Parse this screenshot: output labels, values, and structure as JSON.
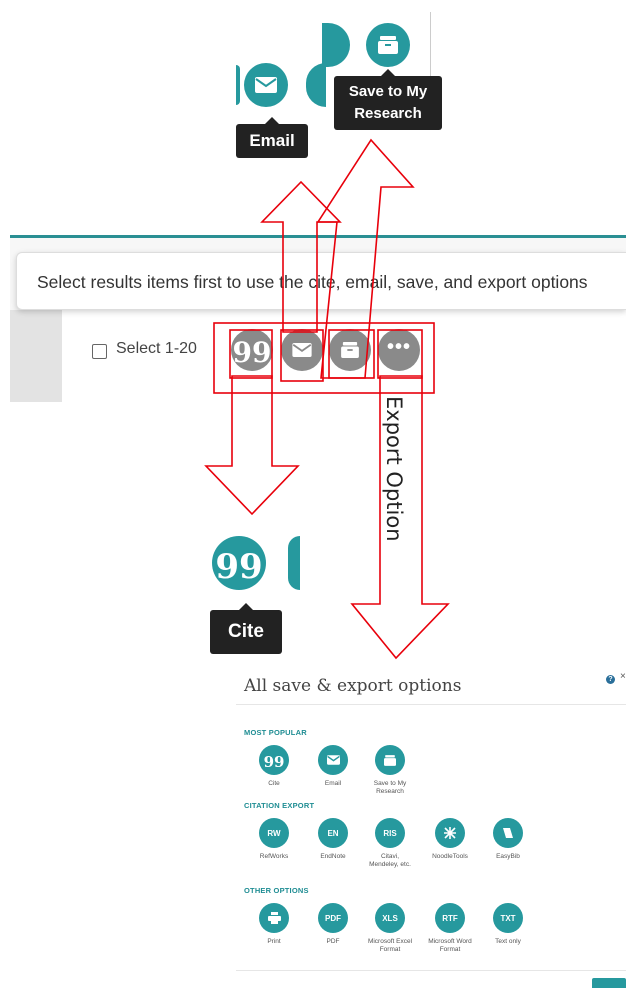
{
  "tooltips": {
    "email": "Email",
    "save_line1": "Save to My",
    "save_line2": "Research",
    "cite": "Cite"
  },
  "banner": {
    "message": "Select results items first to use the cite, email, save, and export options"
  },
  "toolbar": {
    "select_label": "Select 1-20",
    "actions": [
      "cite",
      "email",
      "save-to-my-research",
      "more-options"
    ]
  },
  "annotation": {
    "export_label": "Export Option"
  },
  "panel": {
    "title": "All save & export options",
    "sections": [
      {
        "label": "MOST POPULAR",
        "items": [
          {
            "icon": "quote-icon",
            "glyph": "99",
            "label": "Cite"
          },
          {
            "icon": "envelope-icon",
            "glyph": "",
            "label": "Email"
          },
          {
            "icon": "folder-icon",
            "glyph": "",
            "label": "Save to My Research"
          }
        ]
      },
      {
        "label": "CITATION EXPORT",
        "items": [
          {
            "icon": "refworks-icon",
            "glyph": "RW",
            "label": "RefWorks"
          },
          {
            "icon": "endnote-icon",
            "glyph": "EN",
            "label": "EndNote"
          },
          {
            "icon": "ris-icon",
            "glyph": "RIS",
            "label": "Citavi, Mendeley, etc."
          },
          {
            "icon": "noodletools-icon",
            "glyph": "",
            "label": "NoodleTools"
          },
          {
            "icon": "easybib-icon",
            "glyph": "",
            "label": "EasyBib"
          }
        ]
      },
      {
        "label": "OTHER OPTIONS",
        "items": [
          {
            "icon": "printer-icon",
            "glyph": "",
            "label": "Print"
          },
          {
            "icon": "pdf-icon",
            "glyph": "PDF",
            "label": "PDF"
          },
          {
            "icon": "xls-icon",
            "glyph": "XLS",
            "label": "Microsoft Excel Format"
          },
          {
            "icon": "rtf-icon",
            "glyph": "RTF",
            "label": "Microsoft Word Format"
          },
          {
            "icon": "txt-icon",
            "glyph": "TXT",
            "label": "Text only"
          }
        ]
      }
    ]
  },
  "colors": {
    "teal": "#26999e",
    "grey": "#8a8a8a",
    "annotation_red": "#e8000b",
    "rule_teal": "#2a8f93"
  }
}
